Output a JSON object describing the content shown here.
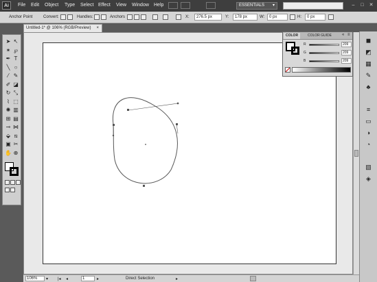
{
  "menubar": {
    "logo": "Ai",
    "items": [
      "File",
      "Edit",
      "Object",
      "Type",
      "Select",
      "Effect",
      "View",
      "Window",
      "Help"
    ],
    "workspace": "ESSENTIALS",
    "window_controls": [
      "–",
      "□",
      "✕"
    ]
  },
  "controlbar": {
    "selection_label": "Anchor Point",
    "convert_label": "Convert:",
    "handles_label": "Handles:",
    "anchors_label": "Anchors",
    "x_label": "X:",
    "x_value": "276.5 px",
    "y_label": "Y:",
    "y_value": "178 px",
    "w_label": "W:",
    "w_value": "0 px",
    "h_label": "H:",
    "h_value": "0 px"
  },
  "document": {
    "tab_title": "Untitled-1* @ 106% (RGB/Preview)",
    "close_glyph": "×"
  },
  "statusbar": {
    "zoom": "106%",
    "page": "1",
    "status_text": "Direct Selection"
  },
  "color_panel": {
    "tabs": [
      "COLOR",
      "COLOR GUIDE"
    ],
    "channels": [
      {
        "label": "R",
        "value": "209"
      },
      {
        "label": "G",
        "value": "209"
      },
      {
        "label": "B",
        "value": "209"
      }
    ]
  },
  "tools": [
    "selection-tool",
    "direct-selection-tool",
    "magic-wand-tool",
    "lasso-tool",
    "pen-tool",
    "type-tool",
    "line-segment-tool",
    "ellipse-tool",
    "paintbrush-tool",
    "pencil-tool",
    "blob-brush-tool",
    "eraser-tool",
    "rotate-tool",
    "scale-tool",
    "warp-tool",
    "free-transform-tool",
    "symbol-sprayer-tool",
    "column-graph-tool",
    "mesh-tool",
    "gradient-tool",
    "eyedropper-tool",
    "blend-tool",
    "live-paint-tool",
    "slice-tool",
    "artboard-tool",
    "scissors-tool",
    "hand-tool",
    "zoom-tool"
  ],
  "dock_icons": [
    "color-panel-icon",
    "color-guide-icon",
    "swatches-icon",
    "brushes-icon",
    "symbols-icon",
    "stroke-icon",
    "gradient-icon",
    "transparency-icon",
    "appearance-icon",
    "graphic-styles-icon",
    "layers-icon"
  ],
  "colors": {
    "ui_dark": "#3e3e3e",
    "ui_light": "#d6d6d6",
    "artboard": "#ffffff",
    "path_stroke": "#555555"
  }
}
